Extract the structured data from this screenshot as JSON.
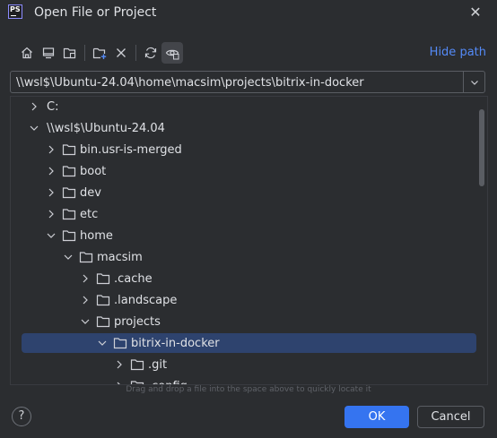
{
  "window": {
    "logo_text": "PS",
    "title": "Open File or Project",
    "close_glyph": "✕"
  },
  "toolbar": {
    "icons": [
      "home-icon",
      "desktop-icon",
      "project-directory-icon",
      "new-folder-icon",
      "delete-icon",
      "refresh-icon",
      "show-hidden-files-icon"
    ],
    "hide_path_label": "Hide path"
  },
  "path": {
    "value": "\\\\wsl$\\Ubuntu-24.04\\home\\macsim\\projects\\bitrix-in-docker"
  },
  "tree": {
    "items": [
      {
        "label": "C:",
        "level": 0,
        "expanded": false,
        "folder": false
      },
      {
        "label": "\\\\wsl$\\Ubuntu-24.04",
        "level": 0,
        "expanded": true,
        "folder": false
      },
      {
        "label": "bin.usr-is-merged",
        "level": 1,
        "expanded": false,
        "folder": true
      },
      {
        "label": "boot",
        "level": 1,
        "expanded": false,
        "folder": true
      },
      {
        "label": "dev",
        "level": 1,
        "expanded": false,
        "folder": true
      },
      {
        "label": "etc",
        "level": 1,
        "expanded": false,
        "folder": true
      },
      {
        "label": "home",
        "level": 1,
        "expanded": true,
        "folder": true
      },
      {
        "label": "macsim",
        "level": 2,
        "expanded": true,
        "folder": true
      },
      {
        "label": ".cache",
        "level": 3,
        "expanded": false,
        "folder": true
      },
      {
        "label": ".landscape",
        "level": 3,
        "expanded": false,
        "folder": true
      },
      {
        "label": "projects",
        "level": 3,
        "expanded": true,
        "folder": true
      },
      {
        "label": "bitrix-in-docker",
        "level": 4,
        "expanded": true,
        "folder": true,
        "selected": true
      },
      {
        "label": ".git",
        "level": 5,
        "expanded": false,
        "folder": true
      },
      {
        "label": ".config",
        "level": 5,
        "expanded": false,
        "folder": true
      }
    ]
  },
  "hint": "Drag and drop a file into the space above to quickly locate it",
  "footer": {
    "help_label": "?",
    "ok_label": "OK",
    "cancel_label": "Cancel"
  },
  "colors": {
    "background": "#2b2d30",
    "accent": "#3574f0",
    "link": "#548af7",
    "selection": "#2e436e"
  }
}
